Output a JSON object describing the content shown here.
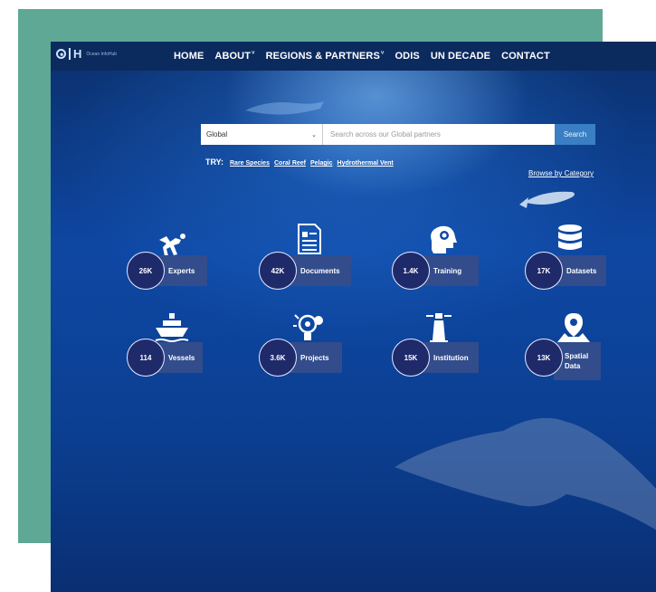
{
  "brand": {
    "logo_text": "Ocean InfoHub",
    "logo_h": "H"
  },
  "nav": {
    "items": [
      {
        "label": "HOME",
        "caret": ""
      },
      {
        "label": "ABOUT",
        "caret": "˅"
      },
      {
        "label": "REGIONS & PARTNERS",
        "caret": "˅"
      },
      {
        "label": "ODIS",
        "caret": ""
      },
      {
        "label": "UN DECADE",
        "caret": ""
      },
      {
        "label": "CONTACT",
        "caret": ""
      }
    ]
  },
  "search": {
    "region_value": "Global",
    "placeholder": "Search across our Global partners",
    "button_label": "Search"
  },
  "try": {
    "label": "TRY:",
    "links": [
      "Rare Species",
      "Coral Reef",
      "Pelagic",
      "Hydrothermal Vent"
    ]
  },
  "browse_label": "Browse by Category",
  "stats": [
    {
      "count": "26K",
      "label": "Experts",
      "icon": "diver-icon"
    },
    {
      "count": "42K",
      "label": "Documents",
      "icon": "document-icon"
    },
    {
      "count": "1.4K",
      "label": "Training",
      "icon": "brain-gear-icon"
    },
    {
      "count": "17K",
      "label": "Datasets",
      "icon": "database-icon"
    },
    {
      "count": "114",
      "label": "Vessels",
      "icon": "ship-icon"
    },
    {
      "count": "3.6K",
      "label": "Projects",
      "icon": "lightbulb-gear-icon"
    },
    {
      "count": "15K",
      "label": "Institution",
      "icon": "lighthouse-icon"
    },
    {
      "count": "13K",
      "label": "Spatial Data",
      "icon": "map-pin-icon"
    }
  ],
  "colors": {
    "teal": "#5fa896",
    "navbar": "#0b2a5e",
    "circle": "#1f2a6b",
    "label_bg": "#324c8c",
    "search_button": "#3a7fc4"
  }
}
